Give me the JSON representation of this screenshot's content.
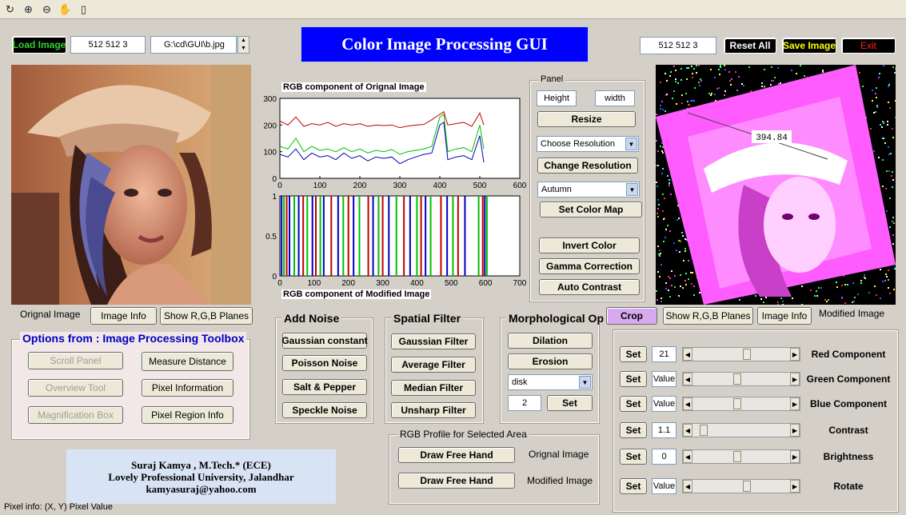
{
  "toolbar": {
    "icons": [
      "rotate-icon",
      "zoom-in-icon",
      "zoom-out-icon",
      "pan-hand-icon",
      "datacursor-icon"
    ]
  },
  "header": {
    "load_image": "Load Image",
    "input_dims": "512  512   3",
    "file_path": "G:\\cd\\GUI\\b.jpg",
    "title": "Color Image Processing GUI",
    "output_dims": "512  512   3",
    "reset_all": "Reset All",
    "save_image": "Save Image",
    "exit": "Exit"
  },
  "left": {
    "orignal_image_label": "Orignal Image",
    "image_info": "Image Info",
    "show_rgb_planes": "Show R,G,B Planes",
    "options_title": "Options from :  Image Processing Toolbox",
    "scroll_panel": "Scroll Panel",
    "overview_tool": "Overview Tool",
    "magnification_box": "Magnification Box",
    "measure_distance": "Measure Distance",
    "pixel_information": "Pixel Information",
    "pixel_region_info": "Pixel Region Info"
  },
  "credits": {
    "line1": "Suraj Kamya , M.Tech.* (ECE)",
    "line2": "Lovely Professional University, Jalandhar",
    "line3": "kamyasuraj@yahoo.com"
  },
  "status": {
    "text": "Pixel info: (X, Y)  Pixel Value"
  },
  "chart_data": [
    {
      "type": "line",
      "title": "RGB component of Orignal Image",
      "xlim": [
        0,
        600
      ],
      "ylim": [
        0,
        300
      ],
      "xticks": [
        "0",
        "100",
        "200",
        "300",
        "400",
        "500",
        "600"
      ],
      "yticks": [
        "0",
        "100",
        "200",
        "300"
      ],
      "x": [
        0,
        20,
        40,
        60,
        80,
        100,
        120,
        140,
        160,
        180,
        200,
        220,
        240,
        260,
        280,
        300,
        320,
        340,
        360,
        380,
        400,
        410,
        420,
        440,
        460,
        480,
        500,
        510
      ],
      "series": [
        {
          "name": "R",
          "color": "#c00000",
          "values": [
            215,
            200,
            230,
            195,
            205,
            200,
            210,
            195,
            205,
            200,
            205,
            195,
            200,
            198,
            200,
            190,
            196,
            200,
            202,
            220,
            240,
            250,
            200,
            205,
            210,
            195,
            245,
            200
          ]
        },
        {
          "name": "G",
          "color": "#00c000",
          "values": [
            120,
            110,
            150,
            100,
            120,
            105,
            110,
            100,
            115,
            100,
            110,
            95,
            105,
            100,
            108,
            90,
            100,
            105,
            110,
            120,
            230,
            240,
            100,
            110,
            115,
            100,
            200,
            110
          ]
        },
        {
          "name": "B",
          "color": "#0000c0",
          "values": [
            90,
            80,
            110,
            70,
            95,
            80,
            85,
            70,
            95,
            75,
            85,
            65,
            80,
            75,
            80,
            55,
            70,
            80,
            90,
            95,
            200,
            210,
            70,
            80,
            85,
            70,
            160,
            60
          ]
        }
      ]
    },
    {
      "type": "bar",
      "title": "RGB component of Modified Image",
      "xlim": [
        0,
        700
      ],
      "ylim": [
        0,
        1
      ],
      "xticks": [
        "0",
        "100",
        "200",
        "300",
        "400",
        "500",
        "600",
        "700"
      ],
      "yticks": [
        "0",
        "0.5",
        "1"
      ],
      "lines": [
        {
          "x": 5,
          "c": "#0000c0"
        },
        {
          "x": 12,
          "c": "#00c000"
        },
        {
          "x": 20,
          "c": "#c00000"
        },
        {
          "x": 28,
          "c": "#0000c0"
        },
        {
          "x": 42,
          "c": "#00c000"
        },
        {
          "x": 55,
          "c": "#0000c0"
        },
        {
          "x": 68,
          "c": "#c00000"
        },
        {
          "x": 80,
          "c": "#00c000"
        },
        {
          "x": 95,
          "c": "#0000c0"
        },
        {
          "x": 105,
          "c": "#c00000"
        },
        {
          "x": 118,
          "c": "#00c000"
        },
        {
          "x": 128,
          "c": "#0000c0"
        },
        {
          "x": 150,
          "c": "#c00000"
        },
        {
          "x": 170,
          "c": "#0000c0"
        },
        {
          "x": 185,
          "c": "#00c000"
        },
        {
          "x": 200,
          "c": "#c00000"
        },
        {
          "x": 215,
          "c": "#0000c0"
        },
        {
          "x": 232,
          "c": "#00c000"
        },
        {
          "x": 258,
          "c": "#c00000"
        },
        {
          "x": 272,
          "c": "#0000c0"
        },
        {
          "x": 288,
          "c": "#00c000"
        },
        {
          "x": 300,
          "c": "#c00000"
        },
        {
          "x": 318,
          "c": "#0000c0"
        },
        {
          "x": 340,
          "c": "#00c000"
        },
        {
          "x": 362,
          "c": "#c00000"
        },
        {
          "x": 380,
          "c": "#0000c0"
        },
        {
          "x": 400,
          "c": "#00c000"
        },
        {
          "x": 412,
          "c": "#c00000"
        },
        {
          "x": 425,
          "c": "#0000c0"
        },
        {
          "x": 440,
          "c": "#00c000"
        },
        {
          "x": 470,
          "c": "#c00000"
        },
        {
          "x": 488,
          "c": "#0000c0"
        },
        {
          "x": 505,
          "c": "#00c000"
        },
        {
          "x": 520,
          "c": "#c00000"
        },
        {
          "x": 540,
          "c": "#0000c0"
        },
        {
          "x": 580,
          "c": "#00c000"
        },
        {
          "x": 592,
          "c": "#c00000"
        },
        {
          "x": 598,
          "c": "#0000c0"
        },
        {
          "x": 604,
          "c": "#00c000"
        }
      ]
    }
  ],
  "noise": {
    "title": "Add Noise",
    "gaussian": "Gaussian constant",
    "poisson": "Poisson Noise",
    "salt": "Salt & Pepper",
    "speckle": "Speckle Noise"
  },
  "spatial": {
    "title": "Spatial Filter",
    "gaussian": "Gaussian Filter",
    "average": "Average Filter",
    "median": "Median Filter",
    "unsharp": "Unsharp Filter"
  },
  "morph": {
    "title": "Morphological Op",
    "dilation": "Dilation",
    "erosion": "Erosion",
    "shape": "disk",
    "size": "2",
    "set": "Set"
  },
  "profile": {
    "title": "RGB Profile for Selected Area",
    "draw1": "Draw Free Hand",
    "label1": "Orignal Image",
    "draw2": "Draw Free Hand",
    "label2": "Modified Image"
  },
  "panel": {
    "title": "Panel",
    "height": "Height",
    "width": "width",
    "resize": "Resize",
    "resolution": "Choose Resolution",
    "change_resolution": "Change Resolution",
    "colormap": "Autumn",
    "set_color_map": "Set Color Map",
    "invert": "Invert Color",
    "gamma": "Gamma Correction",
    "contrast": "Auto Contrast"
  },
  "right": {
    "measure_value": "394.84",
    "crop": "Crop",
    "show_rgb_planes": "Show R,G,B Planes",
    "image_info": "Image Info",
    "modified_label": "Modified Image",
    "sliders": [
      {
        "set": "Set",
        "value": "21",
        "label": "Red Component",
        "level": 0.55
      },
      {
        "set": "Set",
        "value": "Value",
        "label": "Green Component",
        "level": 0.45
      },
      {
        "set": "Set",
        "value": "Value",
        "label": "Blue Component",
        "level": 0.45
      },
      {
        "set": "Set",
        "value": "1.1",
        "label": "Contrast",
        "level": 0.08
      },
      {
        "set": "Set",
        "value": "0",
        "label": "Brightness",
        "level": 0.45
      },
      {
        "set": "Set",
        "value": "Value",
        "label": "Rotate",
        "level": 0.55
      }
    ]
  }
}
